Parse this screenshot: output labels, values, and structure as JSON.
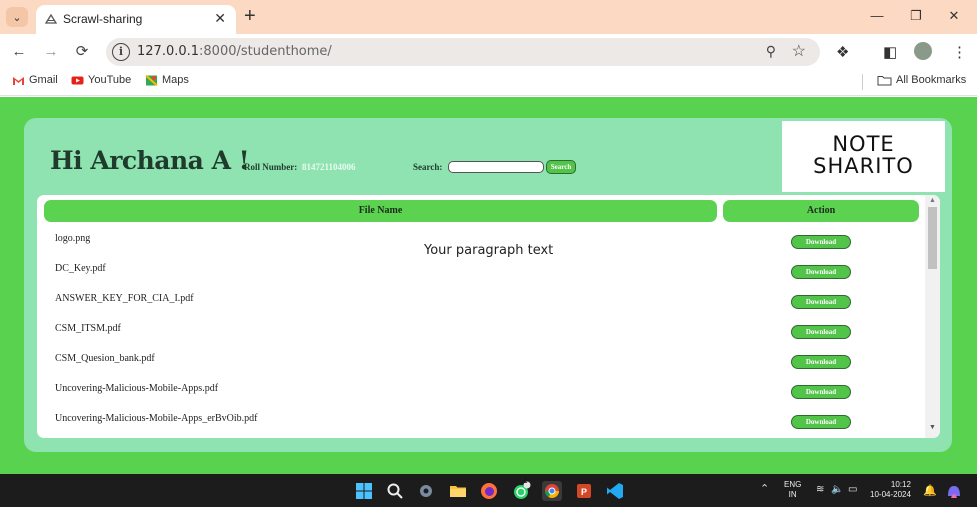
{
  "browser": {
    "tab_title": "Scrawl-sharing",
    "url_host": "127.0.0.1",
    "url_rest": ":8000/studenthome/",
    "bookmarks": [
      {
        "label": "Gmail",
        "icon": "gmail-icon"
      },
      {
        "label": "YouTube",
        "icon": "youtube-icon"
      },
      {
        "label": "Maps",
        "icon": "maps-icon"
      }
    ],
    "all_bookmarks": "All Bookmarks"
  },
  "page": {
    "greeting": "Hi Archana A !",
    "roll_label": "Roll Number:",
    "roll_value": "814721104006",
    "search_label": "Search:",
    "search_value": "",
    "search_button": "Search",
    "logo_line1": "NOTE",
    "logo_line2": "SHARITO",
    "table": {
      "headers": {
        "file": "File Name",
        "action": "Action"
      },
      "rows": [
        {
          "file": "logo.png",
          "action": "Download"
        },
        {
          "file": "DC_Key.pdf",
          "action": "Download"
        },
        {
          "file": "ANSWER_KEY_FOR_CIA_I.pdf",
          "action": "Download"
        },
        {
          "file": "CSM_ITSM.pdf",
          "action": "Download"
        },
        {
          "file": "CSM_Quesion_bank.pdf",
          "action": "Download"
        },
        {
          "file": "Uncovering-Malicious-Mobile-Apps.pdf",
          "action": "Download"
        },
        {
          "file": "Uncovering-Malicious-Mobile-Apps_erBvOib.pdf",
          "action": "Download"
        }
      ]
    },
    "paragraph": "Your paragraph text"
  },
  "taskbar": {
    "lang_line1": "ENG",
    "lang_line2": "IN",
    "time": "10:12",
    "date": "10-04-2024",
    "whatsapp_badge": "2"
  },
  "colors": {
    "page_bg": "#59d34f",
    "panel_bg": "#8fe3b0",
    "header_green": "#5bd351",
    "tab_strip": "#fbd9c2"
  }
}
